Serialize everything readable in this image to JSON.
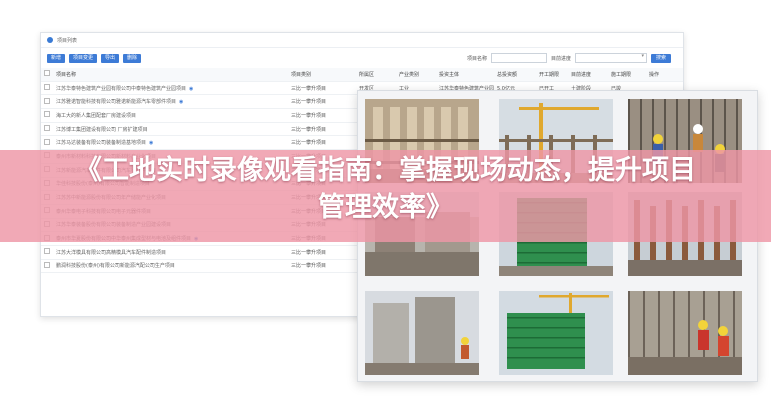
{
  "list_panel": {
    "header_title": "项目列表",
    "toolbar": {
      "add_label": "新增",
      "batch_label": "项目变更",
      "export_label": "导出",
      "delete_label": "删除"
    },
    "filters": {
      "name_label": "项目名称",
      "stage_label": "目前进度",
      "search_label": "搜索"
    },
    "columns": [
      "",
      "项目名称",
      "项目类别",
      "所属区",
      "产业类别",
      "投资主体",
      "总投资额",
      "开工期限",
      "目前进度",
      "施工期限",
      "操作"
    ],
    "rows": [
      {
        "name": "江苏华泰特色建筑产业园有限公司中泰特色建筑产业园项目",
        "type": "三比一攀升项目",
        "district": "开发区",
        "industry": "工业",
        "investor": "江苏华泰特色建筑产业园",
        "amount": "5.0亿元",
        "start": "已开工",
        "stage": "土建阶段",
        "period": "已竣",
        "ops": ""
      },
      {
        "name": "江苏雅诺智能科技有限公司雅诺新能源汽车零部件项目",
        "type": "三比一攀升项目",
        "district": "",
        "industry": "",
        "investor": "",
        "amount": "",
        "start": "",
        "stage": "",
        "period": "",
        "ops": ""
      },
      {
        "name": "海工大的新人集团配套厂房建设项目",
        "type": "三比一攀升项目",
        "district": "",
        "industry": "",
        "investor": "",
        "amount": "",
        "start": "",
        "stage": "",
        "period": "",
        "ops": ""
      },
      {
        "name": "江苏博工集团建设有限公司 厂房扩建项目",
        "type": "三比一攀升项目",
        "district": "",
        "industry": "",
        "investor": "",
        "amount": "",
        "start": "",
        "stage": "",
        "period": "",
        "ops": ""
      },
      {
        "name": "江苏马达装备有限公司装备制造基地项目",
        "type": "三比一攀升项目",
        "district": "",
        "industry": "",
        "investor": "",
        "amount": "",
        "start": "",
        "stage": "",
        "period": "",
        "ops": ""
      },
      {
        "name": "泰州市新材料科技有限公司新材料产业化项目",
        "type": "三比一攀升项目",
        "district": "",
        "industry": "",
        "investor": "",
        "amount": "",
        "start": "",
        "stage": "",
        "period": "",
        "ops": ""
      },
      {
        "name": "江苏新能源汽车配件有限公司汽车零部件项目",
        "type": "三比一攀升项目",
        "district": "",
        "industry": "",
        "investor": "",
        "amount": "",
        "start": "",
        "stage": "",
        "period": "",
        "ops": ""
      },
      {
        "name": "华佳科技股份(泰州)有限公司智能制造项目",
        "type": "三比一攀升项目",
        "district": "",
        "industry": "",
        "investor": "",
        "amount": "",
        "start": "",
        "stage": "",
        "period": "",
        "ops": ""
      },
      {
        "name": "江苏苏中新能源股份有限公司年产储能产业化项目",
        "type": "三比一攀升项目",
        "district": "",
        "industry": "",
        "investor": "",
        "amount": "",
        "start": "",
        "stage": "",
        "period": "",
        "ops": ""
      },
      {
        "name": "泰州华泰电子科技有限公司电子元器件项目",
        "type": "三比一攀升项目",
        "district": "",
        "industry": "",
        "investor": "",
        "amount": "",
        "start": "",
        "stage": "",
        "period": "",
        "ops": ""
      },
      {
        "name": "江苏华泰装备股份有限公司装备制造产业园建设项目",
        "type": "三比一攀升项目",
        "district": "",
        "industry": "",
        "investor": "",
        "amount": "",
        "start": "",
        "stage": "",
        "period": "",
        "ops": ""
      },
      {
        "name": "泰州市华夏股份有限公司中华泰州集成型材与电池及组件项目",
        "type": "三比一攀升项目",
        "district": "",
        "industry": "",
        "investor": "",
        "amount": "",
        "start": "",
        "stage": "",
        "period": "",
        "ops": ""
      },
      {
        "name": "江苏大洋模具有限公司高精模具汽车配件制造项目",
        "type": "三比一攀升项目",
        "district": "",
        "industry": "",
        "investor": "",
        "amount": "",
        "start": "",
        "stage": "",
        "period": "",
        "ops": ""
      },
      {
        "name": "鹏润科技股份(泰州)有限公司新能源汽配公司生产项目",
        "type": "三比一攀升项目",
        "district": "",
        "industry": "",
        "investor": "",
        "amount": "",
        "start": "",
        "stage": "",
        "period": "",
        "ops": ""
      }
    ]
  },
  "video_panel": {
    "tiles": [
      {
        "scene": "scaffold-building"
      },
      {
        "scene": "tower-crane-frame"
      },
      {
        "scene": "workers-rebar"
      },
      {
        "scene": "site-overview"
      },
      {
        "scene": "green-net-building"
      },
      {
        "scene": "rebar-columns"
      },
      {
        "scene": "precast-wall"
      },
      {
        "scene": "green-net-crane"
      },
      {
        "scene": "workers-red"
      }
    ]
  },
  "banner": {
    "title_line1": "《工地实时录像观看指南：掌握现场动态，提升项目",
    "title_line2": "管理效率》"
  },
  "colors": {
    "accent": "#3d7bd6",
    "banner": "#ee96a6",
    "safety_net": "#2f8f4e"
  }
}
